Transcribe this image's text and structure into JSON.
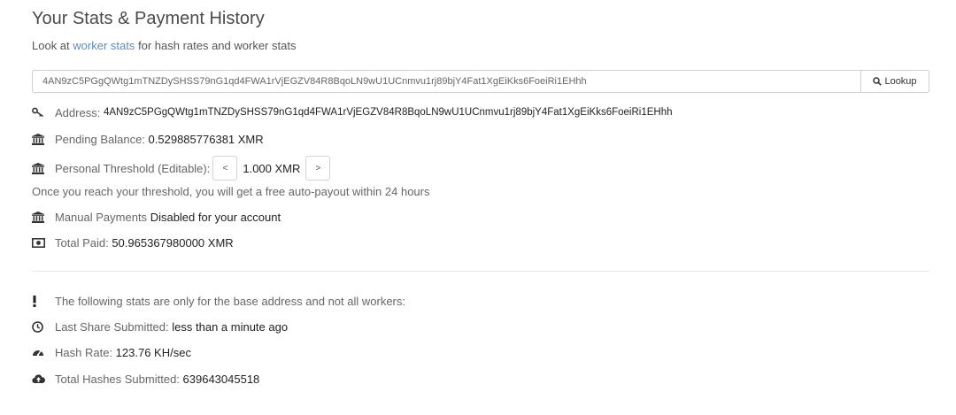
{
  "header": {
    "title": "Your Stats & Payment History",
    "subtitle_prefix": "Look at",
    "subtitle_link": "worker stats",
    "subtitle_suffix": "for hash rates and worker stats"
  },
  "search": {
    "value": "4AN9zC5PGgQWtg1mTNZDySHSS79nG1qd4FWA1rVjEGZV84R8BqoLN9wU1UCnmvu1rj89bjY4Fat1XgEiKks6FoeiRi1EHhh",
    "button_label": "Lookup",
    "button_icon": "search-icon"
  },
  "stats": {
    "address_label": "Address:",
    "address_value": "4AN9zC5PGgQWtg1mTNZDySHSS79nG1qd4FWA1rVjEGZV84R8BqoLN9wU1UCnmvu1rj89bjY4Fat1XgEiKks6FoeiRi1EHhh",
    "pending_label": "Pending Balance:",
    "pending_value": "0.529885776381 XMR",
    "threshold_label": "Personal Threshold (Editable):",
    "threshold_dec": "<",
    "threshold_value": "1.000 XMR",
    "threshold_inc": ">",
    "threshold_note": "Once you reach your threshold, you will get a free auto-payout within 24 hours",
    "manual_label": "Manual Payments",
    "manual_value": "Disabled for your account",
    "paid_label": "Total Paid:",
    "paid_value": "50.965367980000 XMR"
  },
  "base_stats": {
    "notice": "The following stats are only for the base address and not all workers:",
    "last_share_label": "Last Share Submitted:",
    "last_share_value": "less than a minute ago",
    "hashrate_label": "Hash Rate:",
    "hashrate_value": "123.76 KH/sec",
    "total_hashes_label": "Total Hashes Submitted:",
    "total_hashes_value": "639643045518"
  },
  "icons": {
    "address": "key-icon",
    "pending": "bank-icon",
    "threshold": "bank-icon",
    "manual": "bank-icon",
    "paid": "money-icon",
    "notice": "exclamation-icon",
    "last_share": "clock-icon",
    "hashrate": "dashboard-icon",
    "total_hashes": "cloud-upload-icon"
  },
  "colors": {
    "link": "#5b8fc7",
    "text": "#555555",
    "value": "#222222"
  }
}
